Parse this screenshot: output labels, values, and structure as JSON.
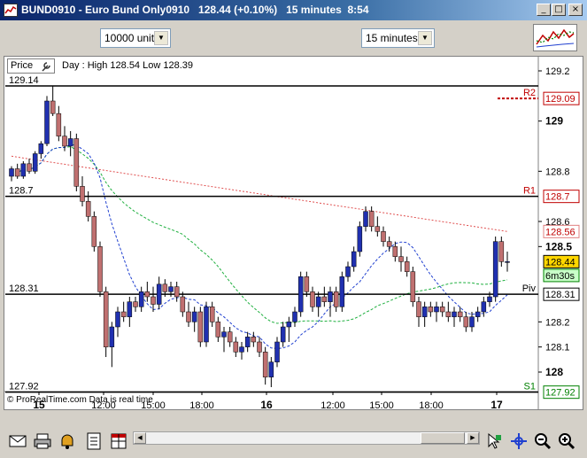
{
  "window": {
    "title": "BUND0910 - Euro Bund Only0910   128.44 (+0.10%)   15 minutes  8:54",
    "buttons": [
      "minimize",
      "maximize",
      "close"
    ]
  },
  "toolbar": {
    "units_select": "10000 units",
    "interval_select": "15 minutes",
    "indicator_icon": "indicator-chart-icon"
  },
  "chart": {
    "price_label": "Price",
    "day_text": "Day : High 128.54 Low 128.39",
    "footer_text": "© ProRealTime.com  Data is real time",
    "left_levels": [
      {
        "label": "129.14",
        "value": 129.14
      },
      {
        "label": "128.7",
        "value": 128.7
      },
      {
        "label": "128.31",
        "value": 128.31
      },
      {
        "label": "127.92",
        "value": 127.92
      }
    ],
    "pivot_labels": [
      {
        "label": "R2",
        "value": 129.09,
        "color": "#c00000"
      },
      {
        "label": "R1",
        "value": 128.7,
        "color": "#c00000"
      },
      {
        "label": "Piv",
        "value": 128.31,
        "color": "#000000"
      },
      {
        "label": "S1",
        "value": 127.92,
        "color": "#008000"
      }
    ],
    "right_ticks": [
      {
        "label": "129.2",
        "value": 129.2
      },
      {
        "label": "129",
        "value": 129.0,
        "bold": true
      },
      {
        "label": "128.8",
        "value": 128.8
      },
      {
        "label": "128.6",
        "value": 128.6
      },
      {
        "label": "128.5",
        "value": 128.5,
        "bold": true
      },
      {
        "label": "128.2",
        "value": 128.2
      },
      {
        "label": "128.1",
        "value": 128.1
      },
      {
        "label": "128",
        "value": 128.0,
        "bold": true
      }
    ],
    "right_tags": [
      {
        "label": "129.09",
        "value": 129.09,
        "border": "#c00000",
        "bg": "#ffffff",
        "color": "#c00000"
      },
      {
        "label": "128.7",
        "value": 128.7,
        "border": "#c00000",
        "bg": "#ffffff",
        "color": "#c00000"
      },
      {
        "label": "128.56",
        "value": 128.56,
        "border": "#e08080",
        "bg": "#ffffff",
        "color": "#c00000"
      },
      {
        "label": "128.44",
        "value": 128.44,
        "border": "#000000",
        "bg": "#ffd700",
        "color": "#000000"
      },
      {
        "label": "6m30s",
        "value": 128.385,
        "border": "#008000",
        "bg": "#c8ffc8",
        "color": "#000000"
      },
      {
        "label": "128.31",
        "value": 128.31,
        "border": "#000000",
        "bg": "#ffffff",
        "color": "#000000"
      },
      {
        "label": "127.92",
        "value": 127.92,
        "border": "#008000",
        "bg": "#ffffff",
        "color": "#008000"
      }
    ],
    "x_ticks": [
      {
        "label": "15",
        "bold": true
      },
      {
        "label": "12:00"
      },
      {
        "label": "15:00"
      },
      {
        "label": "18:00"
      },
      {
        "label": "16",
        "bold": true
      },
      {
        "label": "12:00"
      },
      {
        "label": "15:00"
      },
      {
        "label": "18:00"
      },
      {
        "label": "17",
        "bold": true
      }
    ],
    "colors": {
      "up": "#2030b0",
      "down": "#c07070",
      "ma_red": "#e05050",
      "ma_green": "#20b040",
      "ma_blue": "#2040d0"
    }
  },
  "chart_data": {
    "type": "candlestick",
    "ylim": [
      127.88,
      129.24
    ],
    "candles": [
      [
        128.78,
        128.82,
        128.76,
        128.81
      ],
      [
        128.81,
        128.83,
        128.77,
        128.78
      ],
      [
        128.78,
        128.84,
        128.77,
        128.83
      ],
      [
        128.83,
        128.85,
        128.79,
        128.8
      ],
      [
        128.8,
        128.88,
        128.79,
        128.87
      ],
      [
        128.87,
        128.92,
        128.85,
        128.91
      ],
      [
        128.91,
        129.1,
        128.9,
        129.08
      ],
      [
        129.08,
        129.14,
        129.02,
        129.03
      ],
      [
        129.03,
        129.06,
        128.92,
        128.94
      ],
      [
        128.94,
        128.98,
        128.88,
        128.9
      ],
      [
        128.9,
        128.96,
        128.86,
        128.93
      ],
      [
        128.93,
        128.95,
        128.72,
        128.74
      ],
      [
        128.74,
        128.78,
        128.66,
        128.68
      ],
      [
        128.68,
        128.72,
        128.6,
        128.62
      ],
      [
        128.62,
        128.64,
        128.48,
        128.5
      ],
      [
        128.5,
        128.52,
        128.3,
        128.32
      ],
      [
        128.32,
        128.34,
        128.06,
        128.1
      ],
      [
        128.1,
        128.2,
        128.02,
        128.18
      ],
      [
        128.18,
        128.26,
        128.14,
        128.24
      ],
      [
        128.24,
        128.28,
        128.2,
        128.22
      ],
      [
        128.22,
        128.3,
        128.18,
        128.28
      ],
      [
        128.28,
        128.3,
        128.24,
        128.26
      ],
      [
        128.26,
        128.34,
        128.24,
        128.32
      ],
      [
        128.32,
        128.36,
        128.28,
        128.3
      ],
      [
        128.3,
        128.34,
        128.24,
        128.27
      ],
      [
        128.27,
        128.38,
        128.25,
        128.35
      ],
      [
        128.35,
        128.37,
        128.3,
        128.32
      ],
      [
        128.32,
        128.36,
        128.3,
        128.34
      ],
      [
        128.34,
        128.36,
        128.28,
        128.3
      ],
      [
        128.3,
        128.32,
        128.22,
        128.24
      ],
      [
        128.24,
        128.28,
        128.18,
        128.2
      ],
      [
        128.2,
        128.26,
        128.16,
        128.24
      ],
      [
        128.24,
        128.26,
        128.1,
        128.12
      ],
      [
        128.12,
        128.28,
        128.1,
        128.26
      ],
      [
        128.26,
        128.28,
        128.18,
        128.2
      ],
      [
        128.2,
        128.22,
        128.12,
        128.14
      ],
      [
        128.14,
        128.18,
        128.08,
        128.16
      ],
      [
        128.16,
        128.18,
        128.1,
        128.12
      ],
      [
        128.12,
        128.14,
        128.06,
        128.08
      ],
      [
        128.08,
        128.12,
        128.05,
        128.1
      ],
      [
        128.1,
        128.16,
        128.08,
        128.14
      ],
      [
        128.14,
        128.16,
        128.1,
        128.12
      ],
      [
        128.12,
        128.14,
        128.06,
        128.08
      ],
      [
        128.08,
        128.1,
        127.95,
        127.98
      ],
      [
        127.98,
        128.06,
        127.94,
        128.04
      ],
      [
        128.04,
        128.14,
        128.02,
        128.12
      ],
      [
        128.12,
        128.2,
        128.1,
        128.18
      ],
      [
        128.18,
        128.22,
        128.12,
        128.2
      ],
      [
        128.2,
        128.26,
        128.18,
        128.24
      ],
      [
        128.24,
        128.4,
        128.22,
        128.38
      ],
      [
        128.38,
        128.4,
        128.3,
        128.32
      ],
      [
        128.32,
        128.34,
        128.24,
        128.26
      ],
      [
        128.26,
        128.32,
        128.22,
        128.3
      ],
      [
        128.3,
        128.34,
        128.26,
        128.28
      ],
      [
        128.28,
        128.34,
        128.22,
        128.32
      ],
      [
        128.32,
        128.34,
        128.24,
        128.26
      ],
      [
        128.26,
        128.4,
        128.24,
        128.38
      ],
      [
        128.38,
        128.44,
        128.36,
        128.42
      ],
      [
        128.42,
        128.5,
        128.4,
        128.48
      ],
      [
        128.48,
        128.6,
        128.46,
        128.58
      ],
      [
        128.58,
        128.66,
        128.56,
        128.64
      ],
      [
        128.64,
        128.66,
        128.56,
        128.58
      ],
      [
        128.58,
        128.62,
        128.54,
        128.56
      ],
      [
        128.56,
        128.58,
        128.5,
        128.52
      ],
      [
        128.52,
        128.54,
        128.48,
        128.5
      ],
      [
        128.5,
        128.52,
        128.44,
        128.46
      ],
      [
        128.46,
        128.5,
        128.4,
        128.44
      ],
      [
        128.44,
        128.46,
        128.38,
        128.4
      ],
      [
        128.4,
        128.42,
        128.26,
        128.28
      ],
      [
        128.28,
        128.3,
        128.18,
        128.22
      ],
      [
        128.22,
        128.28,
        128.18,
        128.26
      ],
      [
        128.26,
        128.28,
        128.22,
        128.24
      ],
      [
        128.24,
        128.28,
        128.2,
        128.26
      ],
      [
        128.26,
        128.28,
        128.22,
        128.24
      ],
      [
        128.24,
        128.28,
        128.2,
        128.22
      ],
      [
        128.22,
        128.26,
        128.18,
        128.24
      ],
      [
        128.24,
        128.26,
        128.2,
        128.22
      ],
      [
        128.22,
        128.24,
        128.16,
        128.18
      ],
      [
        128.18,
        128.24,
        128.16,
        128.22
      ],
      [
        128.22,
        128.26,
        128.2,
        128.24
      ],
      [
        128.24,
        128.3,
        128.22,
        128.28
      ],
      [
        128.28,
        128.32,
        128.26,
        128.3
      ],
      [
        128.3,
        128.54,
        128.28,
        128.52
      ],
      [
        128.52,
        128.54,
        128.42,
        128.44
      ],
      [
        128.44,
        128.48,
        128.4,
        128.44
      ]
    ]
  },
  "bottom_toolbar": {
    "icons": [
      "mail-icon",
      "print-icon",
      "bell-icon",
      "list-icon",
      "table-icon"
    ],
    "right_icons": [
      "cursor-icon",
      "crosshair-icon",
      "zoom-out-icon",
      "zoom-in-icon",
      "fit-icon"
    ]
  }
}
